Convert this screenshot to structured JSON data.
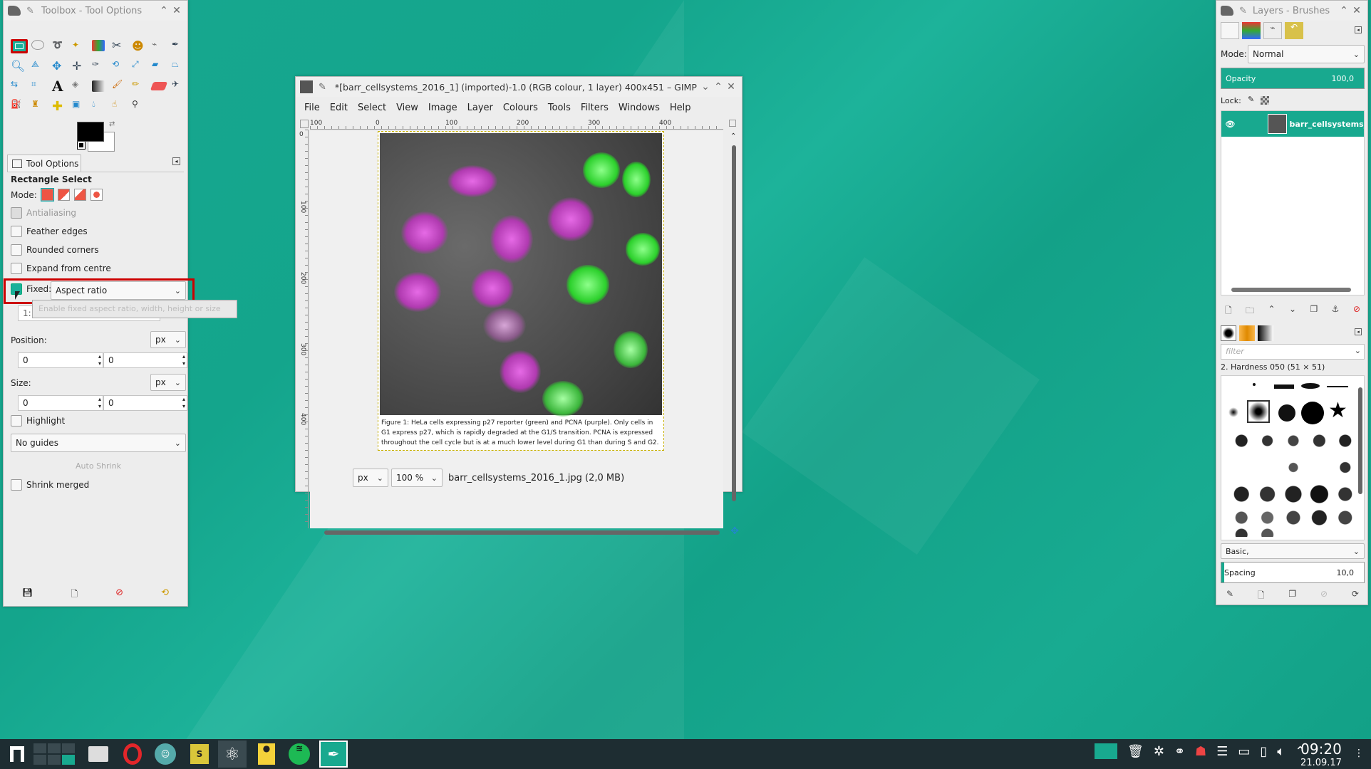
{
  "toolbox": {
    "title": "Toolbox - Tool Options",
    "tool_options_tab": "Tool Options",
    "tool_name": "Rectangle Select",
    "mode_label": "Mode:",
    "antialiasing": "Antialiasing",
    "feather_edges": "Feather edges",
    "rounded_corners": "Rounded corners",
    "expand_from_centre": "Expand from centre",
    "fixed_label": "Fixed:",
    "fixed_value": "Aspect ratio",
    "tooltip": "Enable fixed aspect ratio, width, height or size",
    "ratio_value": "1:1",
    "position_label": "Position:",
    "position_unit": "px",
    "position_x": "0",
    "position_y": "0",
    "size_label": "Size:",
    "size_unit": "px",
    "size_w": "0",
    "size_h": "0",
    "highlight": "Highlight",
    "guides": "No guides",
    "auto_shrink": "Auto Shrink",
    "shrink_merged": "Shrink merged"
  },
  "image_window": {
    "title": "*[barr_cellsystems_2016_1] (imported)-1.0 (RGB colour, 1 layer) 400x451 – GIMP",
    "menu": [
      "File",
      "Edit",
      "Select",
      "View",
      "Image",
      "Layer",
      "Colours",
      "Tools",
      "Filters",
      "Windows",
      "Help"
    ],
    "ruler_h": [
      "100",
      "0",
      "100",
      "200",
      "300",
      "400"
    ],
    "ruler_v": [
      "0",
      "100",
      "200",
      "300",
      "400"
    ],
    "caption": "Figure 1: HeLa cells expressing p27 reporter (green) and PCNA (purple).  Only cells in G1 express p27, which is rapidly degraded at the G1/S transition. PCNA is expressed throughout the cell cycle but is at a much lower level during G1 than during S and G2.",
    "unit": "px",
    "zoom": "100 %",
    "status": "barr_cellsystems_2016_1.jpg (2,0 MB)"
  },
  "layers": {
    "title": "Layers - Brushes",
    "mode_label": "Mode:",
    "mode_value": "Normal",
    "opacity_label": "Opacity",
    "opacity_value": "100,0",
    "opacity_fraction": 1.0,
    "lock_label": "Lock:",
    "layer_name": "barr_cellsystems_",
    "filter_placeholder": "filter",
    "brush_name": "2. Hardness 050 (51 × 51)",
    "brush_tag": "Basic,",
    "spacing_label": "Spacing",
    "spacing_value": "10,0"
  },
  "taskbar": {
    "time": "09:20",
    "date": "21.09.17"
  },
  "colors": {
    "accent": "#18a98f",
    "highlight_red": "#cc0000"
  }
}
